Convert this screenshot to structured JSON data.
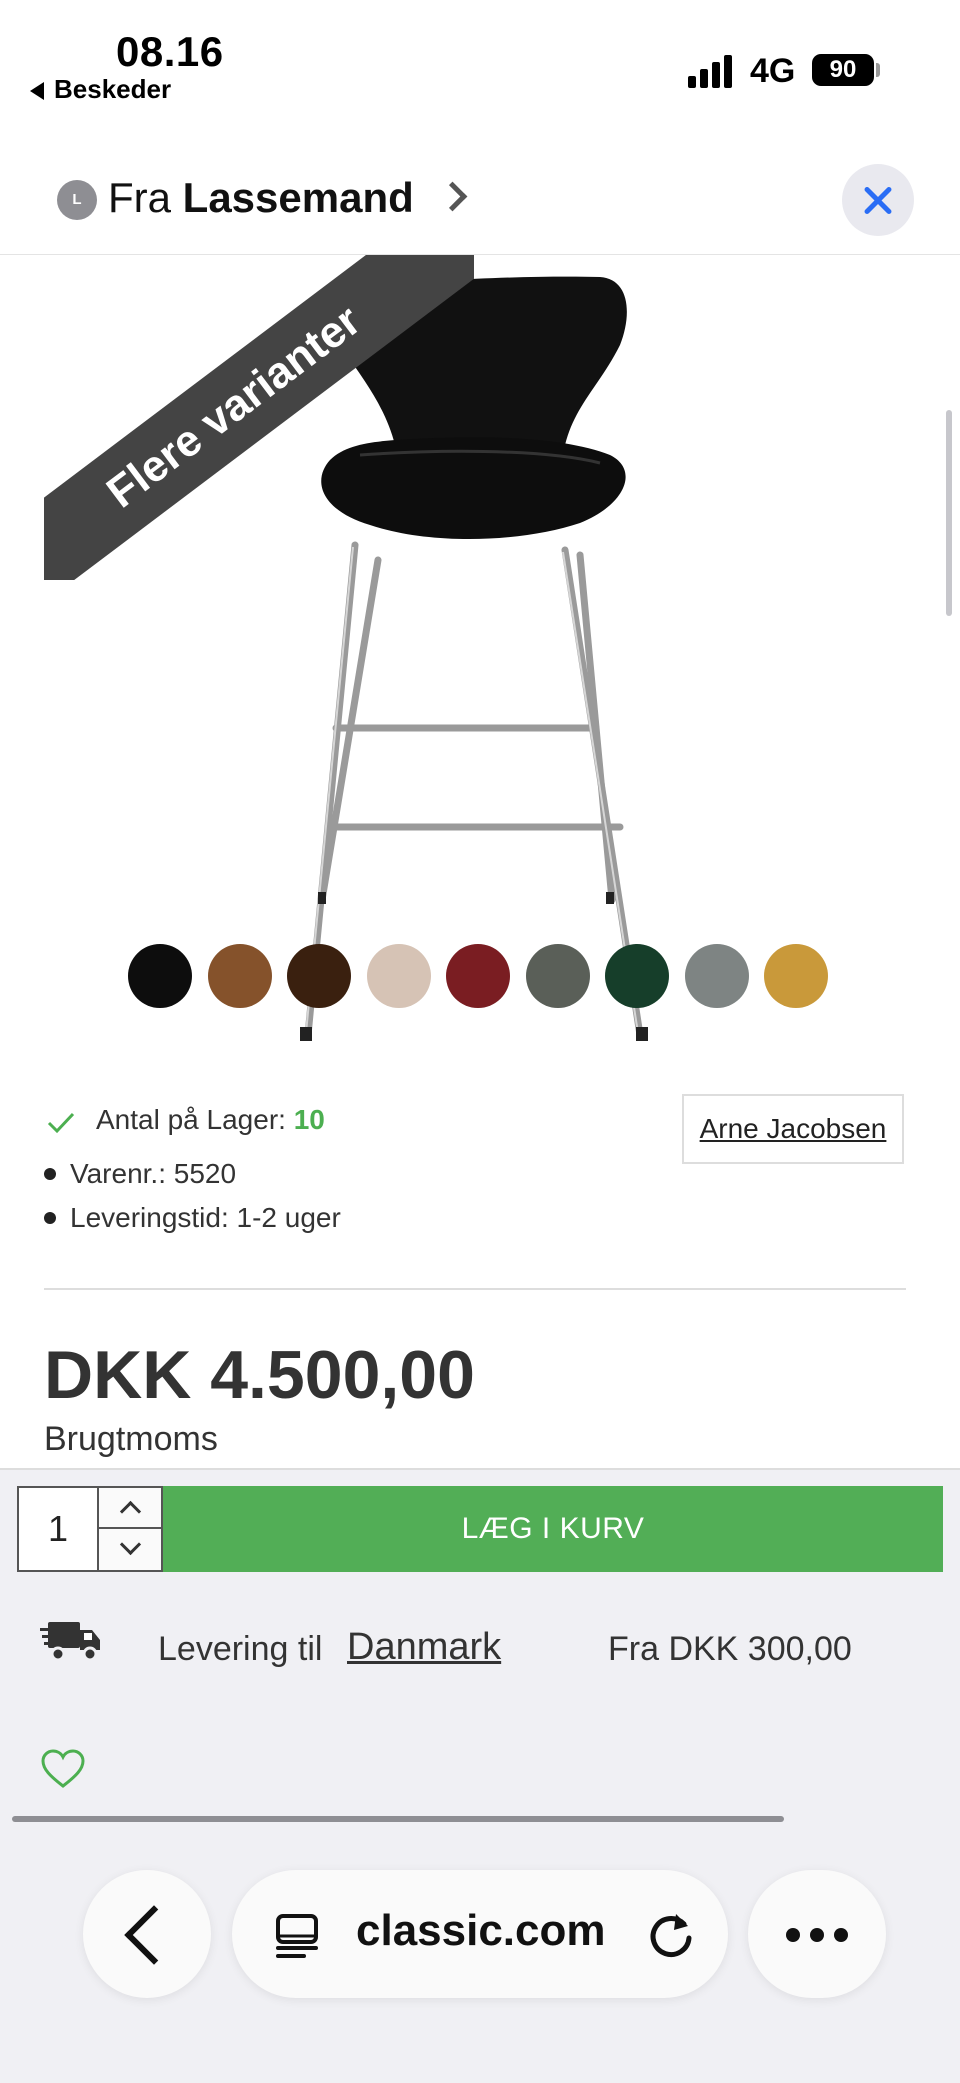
{
  "status_bar": {
    "time": "08.16",
    "back_app": "Beskeder",
    "network": "4G",
    "battery": "90"
  },
  "header": {
    "avatar_letter": "L",
    "source_prefix": "Fra",
    "source_name": "Lassemand"
  },
  "product": {
    "ribbon": "Flere varianter",
    "swatches": [
      {
        "name": "black",
        "color": "#0d0d0d"
      },
      {
        "name": "cognac",
        "color": "#85522b"
      },
      {
        "name": "dark-brown",
        "color": "#3a200f"
      },
      {
        "name": "sand",
        "color": "#d6c3b5"
      },
      {
        "name": "red",
        "color": "#7a1d22"
      },
      {
        "name": "grey-green",
        "color": "#5a5f58"
      },
      {
        "name": "dark-green",
        "color": "#163e2a"
      },
      {
        "name": "grey",
        "color": "#7e8483"
      },
      {
        "name": "mustard",
        "color": "#c9993a"
      }
    ],
    "stock_label": "Antal på Lager:",
    "stock_count": "10",
    "sku": "Varenr.: 5520",
    "delivery_time": "Leveringstid: 1-2 uger",
    "designer": "Arne Jacobsen",
    "price": "DKK 4.500,00",
    "vat_note": "Brugtmoms"
  },
  "cart": {
    "quantity": "1",
    "add_label": "LÆG I KURV",
    "accent_color": "#52ae56"
  },
  "delivery": {
    "label": "Levering til",
    "country": "Danmark",
    "price": "Fra DKK 300,00"
  },
  "browser": {
    "url": "classic.com"
  }
}
